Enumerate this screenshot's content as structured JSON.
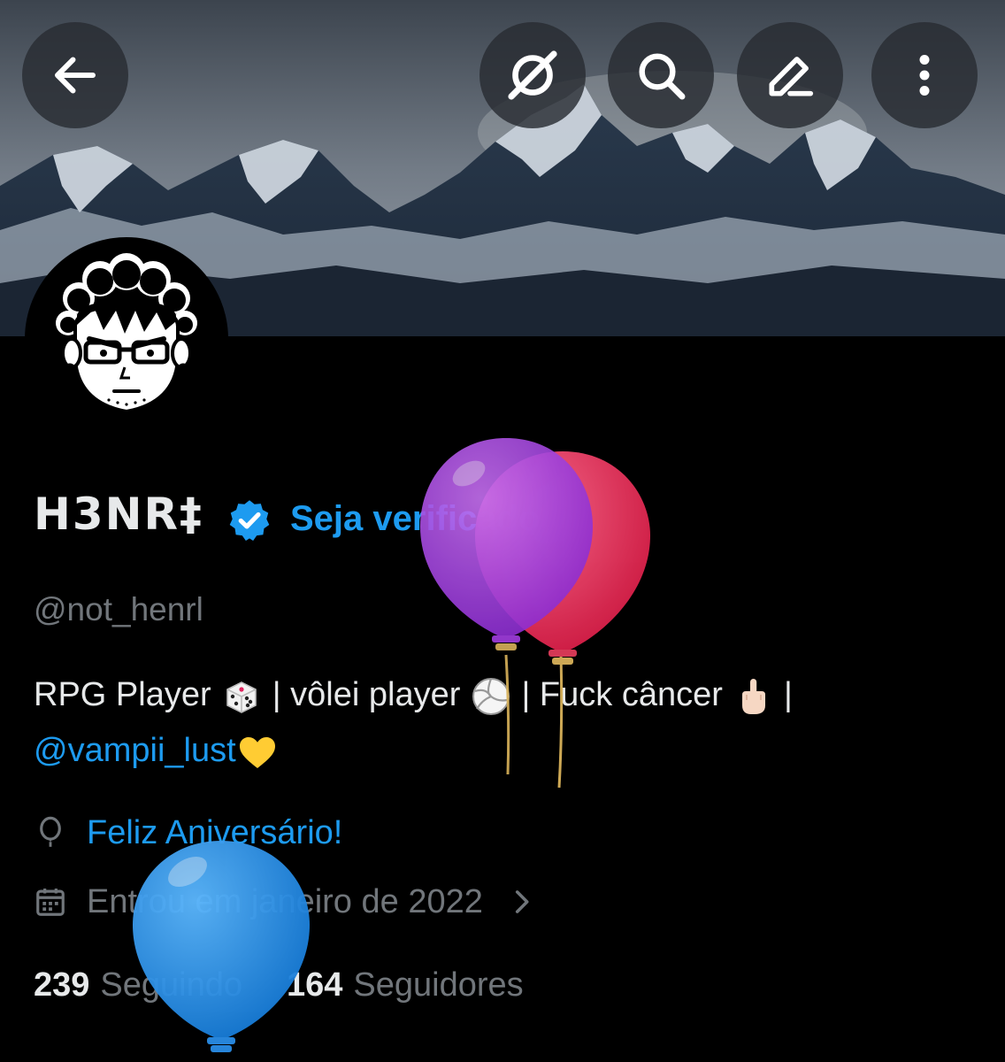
{
  "header": {
    "back_icon": "arrow-left-icon",
    "actions": [
      "grok-icon",
      "search-icon",
      "edit-icon",
      "more-vertical-icon"
    ]
  },
  "profile": {
    "display_name": "H3NR‡",
    "verified": true,
    "get_verified_label": "Seja verificado",
    "handle": "@not_henrl",
    "bio": {
      "line1_a": "RPG Player ",
      "line1_b": " | vôlei player ",
      "line1_c": " |  Fuck câncer ",
      "line1_d": " |",
      "mention": "@vampii_lust",
      "emojis": [
        "dice-emoji",
        "volleyball-emoji",
        "middle-finger-emoji",
        "yellow-heart-emoji"
      ]
    },
    "birthday_label": "Feliz Aniversário!",
    "joined_label": "Entrou em janeiro de 2022",
    "following_count": "239",
    "following_label": "Seguindo",
    "followers_count": "164",
    "followers_label": "Seguidores"
  },
  "colors": {
    "accent": "#1d9bf0",
    "muted": "#71767b",
    "text": "#e7e9ea",
    "background": "#000000"
  }
}
